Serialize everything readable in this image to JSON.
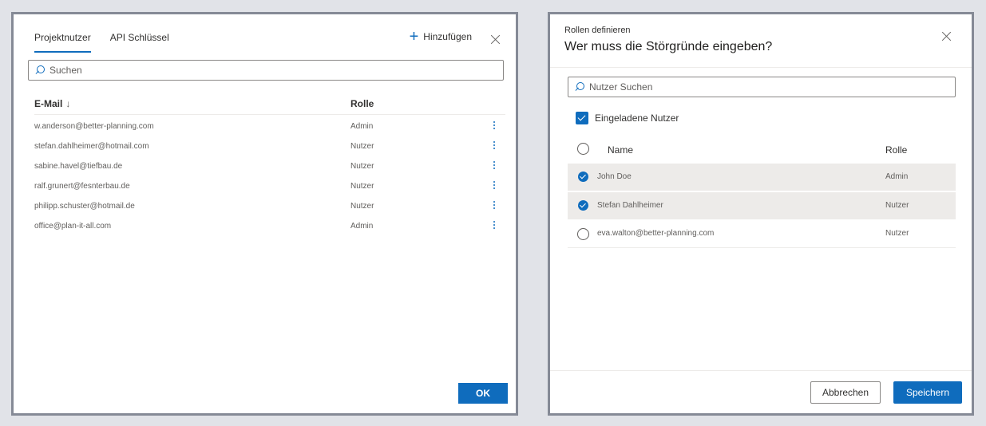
{
  "left_panel": {
    "tabs": [
      {
        "label": "Projektnutzer",
        "active": true
      },
      {
        "label": "API Schlüssel",
        "active": false
      }
    ],
    "add_label": "Hinzufügen",
    "search_placeholder": "Suchen",
    "columns": {
      "email": "E-Mail",
      "sort_arrow": "↓",
      "role": "Rolle"
    },
    "rows": [
      {
        "email": "w.anderson@better-planning.com",
        "role": "Admin"
      },
      {
        "email": "stefan.dahlheimer@hotmail.com",
        "role": "Nutzer"
      },
      {
        "email": "sabine.havel@tiefbau.de",
        "role": "Nutzer"
      },
      {
        "email": "ralf.grunert@fesnterbau.de",
        "role": "Nutzer"
      },
      {
        "email": "philipp.schuster@hotmail.de",
        "role": "Nutzer"
      },
      {
        "email": "office@plan-it-all.com",
        "role": "Admin"
      }
    ],
    "ok_label": "OK"
  },
  "right_panel": {
    "subtitle": "Rollen definieren",
    "title": "Wer muss die Störgründe eingeben?",
    "search_placeholder": "Nutzer Suchen",
    "invited_label": "Eingeladene Nutzer",
    "columns": {
      "name": "Name",
      "role": "Rolle"
    },
    "rows": [
      {
        "name": "John Doe",
        "role": "Admin",
        "selected": true
      },
      {
        "name": "Stefan Dahlheimer",
        "role": "Nutzer",
        "selected": true
      },
      {
        "name": "eva.walton@better-planning.com",
        "role": "Nutzer",
        "selected": false
      }
    ],
    "cancel_label": "Abbrechen",
    "save_label": "Speichern"
  },
  "colors": {
    "accent": "#0f6cbd",
    "background": "#e1e3e8",
    "border": "#858a96"
  }
}
